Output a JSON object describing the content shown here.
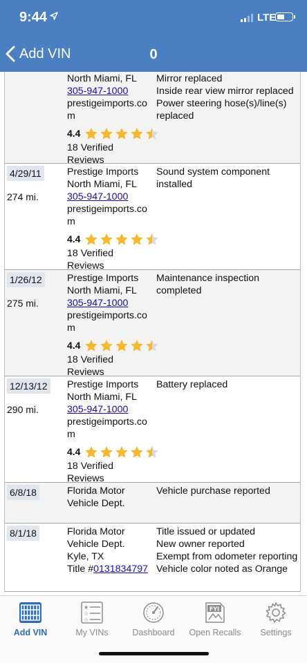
{
  "status_bar": {
    "time": "9:44",
    "network": "LTE"
  },
  "navbar": {
    "back_label": "Add VIN",
    "count": "0"
  },
  "records": [
    {
      "date": "",
      "mileage": "",
      "source": {
        "name": "",
        "location": "North Miami, FL",
        "phone": "305-947-1000",
        "website": "prestigeimports.co m",
        "rating": "4.4",
        "stars": 4.5,
        "reviews": "18 Verified Reviews"
      },
      "details": [
        "Mirror replaced",
        "Inside rear view mirror replaced",
        "Power steering hose(s)/line(s) replaced"
      ]
    },
    {
      "date": "4/29/11",
      "mileage": "274 mi.",
      "source": {
        "name": "Prestige Imports",
        "location": "North Miami, FL",
        "phone": "305-947-1000",
        "website": "prestigeimports.co m",
        "rating": "4.4",
        "stars": 4.5,
        "reviews": "18 Verified Reviews"
      },
      "details": [
        "Sound system component installed"
      ]
    },
    {
      "date": "1/26/12",
      "mileage": "275 mi.",
      "source": {
        "name": "Prestige Imports",
        "location": "North Miami, FL",
        "phone": "305-947-1000",
        "website": "prestigeimports.co m",
        "rating": "4.4",
        "stars": 4.5,
        "reviews": "18 Verified Reviews"
      },
      "details": [
        "Maintenance inspection completed"
      ]
    },
    {
      "date": "12/13/12",
      "mileage": "290 mi.",
      "source": {
        "name": "Prestige Imports",
        "location": "North Miami, FL",
        "phone": "305-947-1000",
        "website": "prestigeimports.co m",
        "rating": "4.4",
        "stars": 4.5,
        "reviews": "18 Verified Reviews"
      },
      "details": [
        "Battery replaced"
      ]
    },
    {
      "date": "6/8/18",
      "mileage": "",
      "source": {
        "name": "Florida Motor Vehicle Dept."
      },
      "details": [
        "Vehicle purchase reported"
      ]
    },
    {
      "date": "8/1/18",
      "mileage": "",
      "source": {
        "name": "Florida Motor Vehicle Dept.",
        "location": "Kyle, TX",
        "title_prefix": "Title #",
        "title_number": "0131834797"
      },
      "details": [
        "Title issued or updated",
        "New owner reported",
        "Exempt from odometer reporting",
        "Vehicle color noted as Orange"
      ]
    }
  ],
  "tabs": [
    {
      "label": "Add VIN",
      "icon": "vin-grid-icon",
      "active": true
    },
    {
      "label": "My VINs",
      "icon": "list-icon",
      "active": false
    },
    {
      "label": "Dashboard",
      "icon": "speedometer-icon",
      "active": false
    },
    {
      "label": "Open Recalls",
      "icon": "fyi-document-icon",
      "active": false
    },
    {
      "label": "Settings",
      "icon": "gear-icon",
      "active": false
    }
  ],
  "colors": {
    "header": "#4a7fc1",
    "accent": "#2f6db5",
    "star": "#f5b82e",
    "link": "#1a0dab"
  }
}
